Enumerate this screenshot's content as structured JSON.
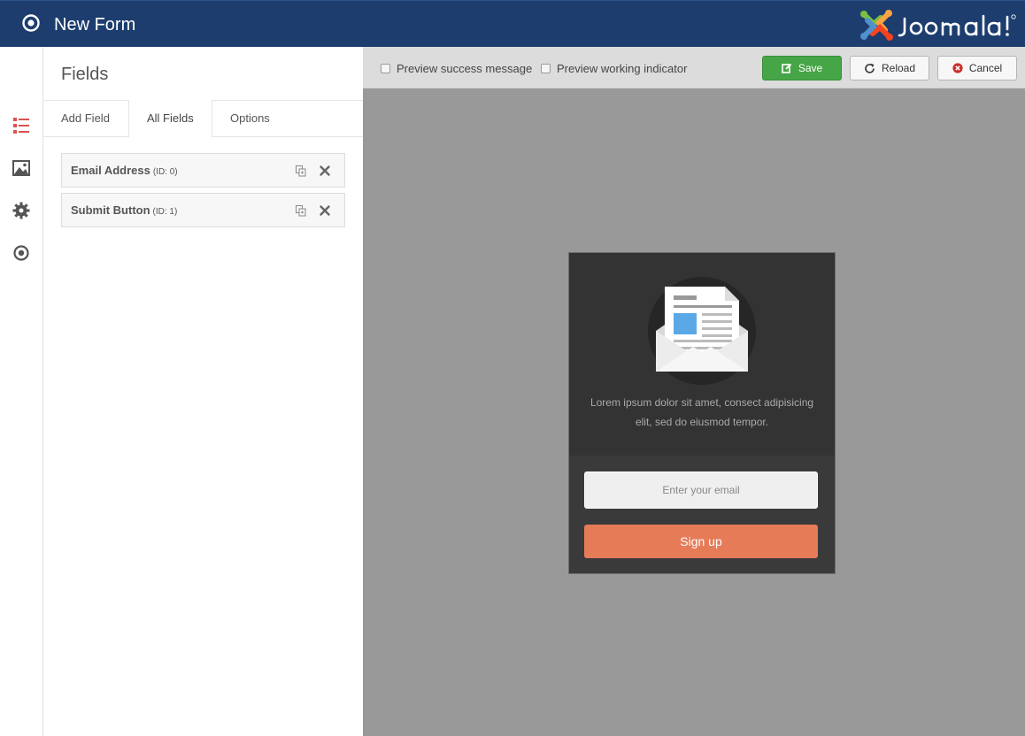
{
  "header": {
    "title": "New Form",
    "brand": "Joomla!",
    "icons": {
      "app": "target-icon",
      "brand": "joomla-logo"
    }
  },
  "rail": {
    "items": [
      {
        "name": "fields",
        "icon": "list-icon",
        "active": true
      },
      {
        "name": "design",
        "icon": "image-icon",
        "active": false
      },
      {
        "name": "settings",
        "icon": "gear-icon",
        "active": false
      },
      {
        "name": "integrations",
        "icon": "target-icon",
        "active": false
      }
    ]
  },
  "panel": {
    "title": "Fields",
    "tabs": [
      {
        "label": "Add Field",
        "active": false
      },
      {
        "label": "All Fields",
        "active": true
      },
      {
        "label": "Options",
        "active": false
      }
    ],
    "fields": [
      {
        "name": "Email Address",
        "id": "(ID: 0)"
      },
      {
        "name": "Submit Button",
        "id": "(ID: 1)"
      }
    ]
  },
  "toolbar": {
    "preview_success": "Preview success message",
    "preview_working": "Preview working indicator",
    "preview_success_checked": false,
    "preview_working_checked": false,
    "save_label": "Save",
    "reload_label": "Reload",
    "cancel_label": "Cancel"
  },
  "preview": {
    "description": "Lorem ipsum dolor sit amet, consect adipisicing elit, sed do eiusmod tempor.",
    "email_placeholder": "Enter your email",
    "signup_label": "Sign up",
    "icon": "newsletter-envelope-icon"
  },
  "colors": {
    "header_bg": "#1c3d6e",
    "accent_red": "#d9534f",
    "save_green": "#46a546",
    "signup_orange": "#e67b57",
    "stage_bg": "#999999"
  }
}
